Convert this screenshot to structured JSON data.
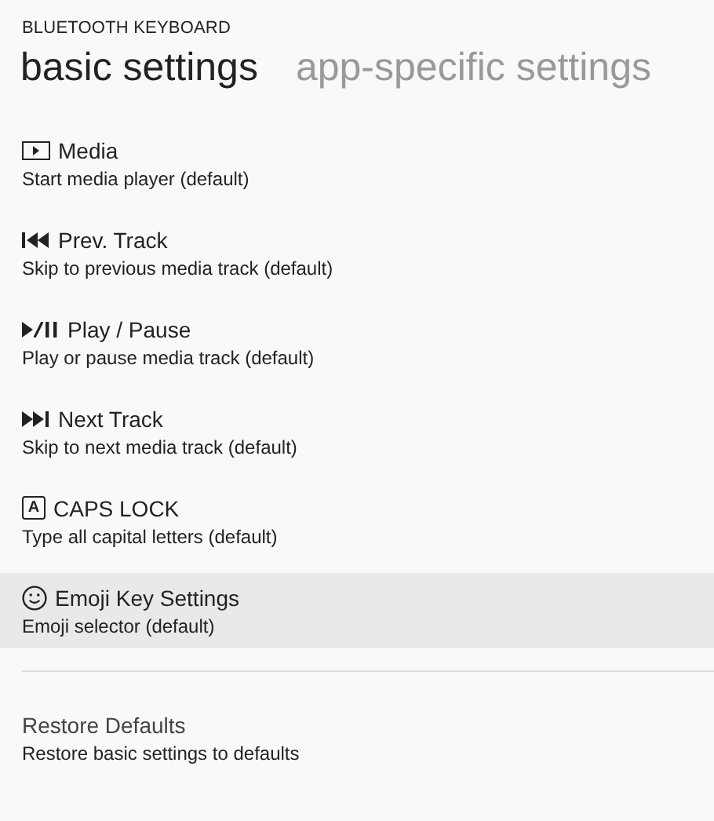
{
  "header": "BLUETOOTH KEYBOARD",
  "tabs": [
    {
      "label": "basic settings",
      "selected": true
    },
    {
      "label": "app-specific settings",
      "selected": false
    }
  ],
  "items": [
    {
      "kind": "media",
      "title": "Media",
      "subtitle": "Start media player (default)",
      "selected": false
    },
    {
      "kind": "prev",
      "title": "Prev. Track",
      "subtitle": "Skip to previous media track (default)",
      "selected": false
    },
    {
      "kind": "playpause",
      "title": "Play / Pause",
      "subtitle": "Play or pause media track (default)",
      "selected": false
    },
    {
      "kind": "next",
      "title": "Next Track",
      "subtitle": "Skip to next media track (default)",
      "selected": false
    },
    {
      "kind": "caps",
      "icon_letter": "A",
      "title": "CAPS LOCK",
      "subtitle": "Type all capital letters (default)",
      "selected": false
    },
    {
      "kind": "emoji",
      "title": "Emoji Key Settings",
      "subtitle": "Emoji selector (default)",
      "selected": true
    }
  ],
  "restore": {
    "title": "Restore Defaults",
    "subtitle": "Restore basic settings to defaults"
  }
}
